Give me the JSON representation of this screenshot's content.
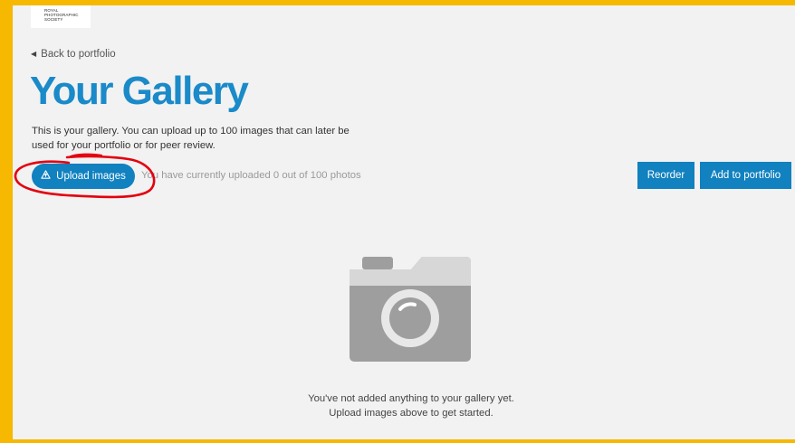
{
  "logo": {
    "lines": [
      "ROYAL",
      "PHOTOGRAPHIC",
      "SOCIETY"
    ]
  },
  "nav": {
    "back_label": "Back to portfolio",
    "back_icon": "caret-left-icon"
  },
  "page": {
    "title": "Your Gallery",
    "description": "This is your gallery. You can upload up to 100 images that can later be used for your portfolio or for peer review."
  },
  "toolbar": {
    "upload_label": "Upload images",
    "upload_icon": "upload-icon",
    "status_text": "You have currently uploaded 0 out of 100 photos",
    "reorder_label": "Reorder",
    "add_to_portfolio_label": "Add to portfolio"
  },
  "empty_state": {
    "icon": "camera-icon",
    "message": "You've not added anything to your gallery yet. Upload images above to get started."
  },
  "colors": {
    "accent": "#1181bf",
    "title": "#1a8ac9",
    "frame": "#f6b800",
    "annotation": "#e3000f",
    "background": "#f2f2f2"
  }
}
